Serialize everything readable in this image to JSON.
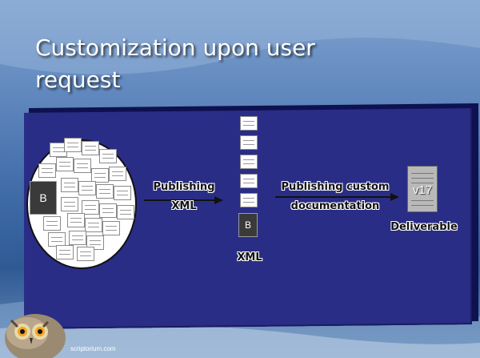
{
  "slide": {
    "title": "Customization upon user request",
    "footer": "scriptorium.com"
  },
  "diagram": {
    "source_block_label": "B",
    "arrow1_label_line1": "Publishing",
    "arrow1_label_line2": "XML",
    "xml_block_label": "B",
    "xml_caption": "XML",
    "arrow2_label_line1": "Publishing custom",
    "arrow2_label_line2": "documentation",
    "deliverable_version": "v17",
    "deliverable_caption": "Deliverable"
  },
  "colors": {
    "panel": "#2a2d86",
    "title_text": "#ffffff"
  }
}
